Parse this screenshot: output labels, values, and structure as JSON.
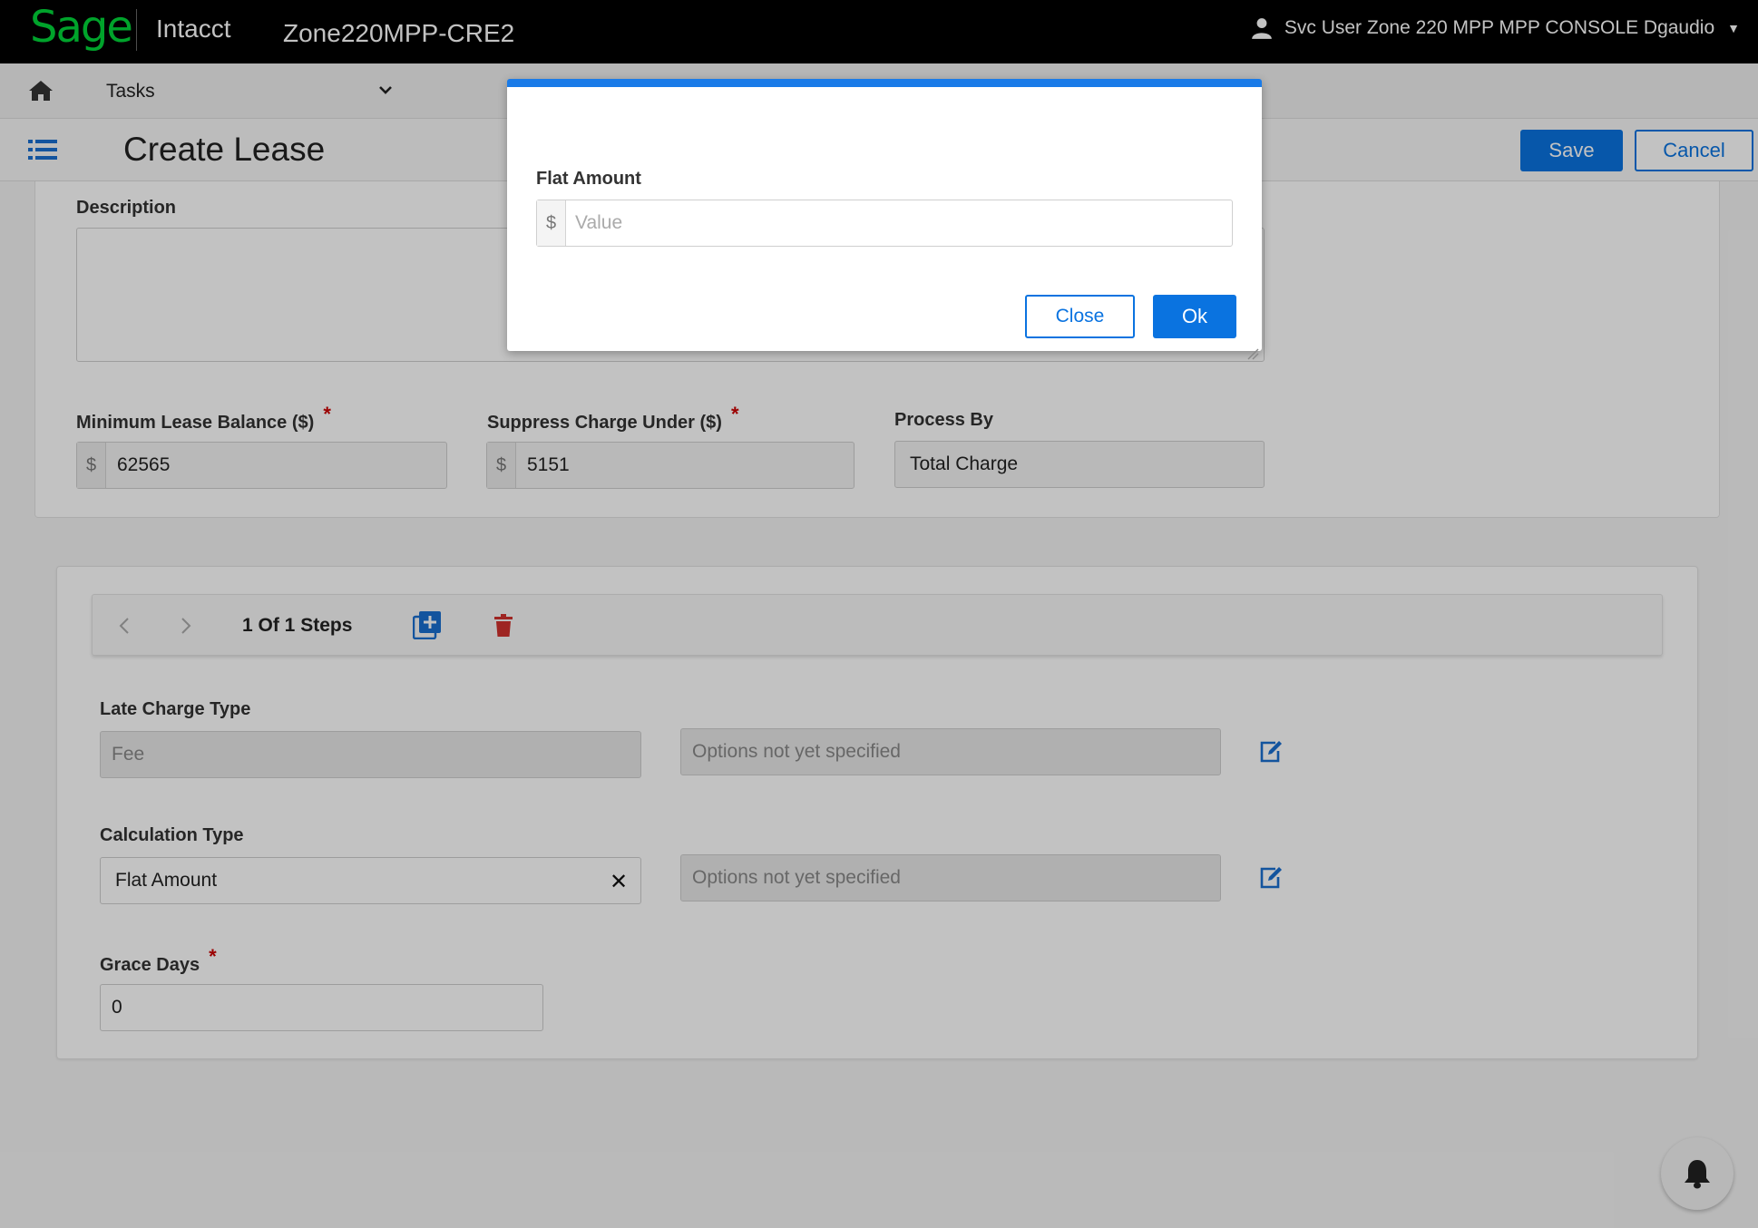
{
  "header": {
    "logo": "Sage",
    "product": "Intacct",
    "company": "Zone220MPP-CRE2",
    "user_name": "Svc User Zone 220 MPP MPP CONSOLE Dgaudio"
  },
  "tasks_bar": {
    "label": "Tasks"
  },
  "page": {
    "title": "Create Lease",
    "save_label": "Save",
    "cancel_label": "Cancel"
  },
  "form": {
    "description_label": "Description",
    "description_value": "",
    "min_lease_balance_label": "Minimum Lease Balance ($)",
    "min_lease_balance_value": "62565",
    "suppress_charge_label": "Suppress Charge Under ($)",
    "suppress_charge_value": "5151",
    "process_by_label": "Process By",
    "process_by_value": "Total Charge",
    "currency_prefix": "$",
    "required_marker": "*"
  },
  "steps": {
    "counter_text": "1 Of 1 Steps",
    "late_charge_type_label": "Late Charge Type",
    "late_charge_type_value": "Fee",
    "late_charge_options_placeholder": "Options not yet specified",
    "calculation_type_label": "Calculation Type",
    "calculation_type_value": "Flat Amount",
    "calculation_options_placeholder": "Options not yet specified",
    "grace_days_label": "Grace Days",
    "grace_days_value": "0"
  },
  "modal": {
    "field_label": "Flat Amount",
    "field_prefix": "$",
    "field_placeholder": "Value",
    "field_value": "",
    "close_label": "Close",
    "ok_label": "Ok"
  },
  "icons": {
    "logo": "sage-logo",
    "user": "user-icon",
    "home": "home-icon",
    "list": "list-icon",
    "add_step": "add-step-icon",
    "delete_step": "trash-icon",
    "edit": "edit-icon",
    "clear": "close-icon",
    "bell": "bell-icon"
  },
  "colors": {
    "brand_green": "#00d639",
    "primary_blue": "#0a73e0",
    "modal_accent": "#1a7be8",
    "delete_red": "#d0312d",
    "required_red": "#cc0000"
  }
}
